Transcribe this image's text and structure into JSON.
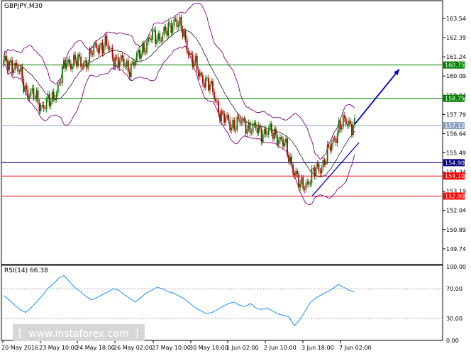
{
  "colors": {
    "frame": "#000000",
    "candle_up": "#008000",
    "candle_down": "#b00000",
    "bollinger": "#800080",
    "ma": "#000000",
    "rsi": "#1e90ff",
    "trend_arrow": "#0000cc",
    "green_level": "#008000",
    "blue_level": "#000080",
    "red_level": "#ff0000",
    "gray_level": "#8ea2c6",
    "watermark_bg": "#d6d6d6"
  },
  "header": {
    "symbol": "GBPJPY,M30",
    "rsi_title": "RSI(14) 66.38",
    "watermark": "www.instaforex.com"
  },
  "chart_data": [
    {
      "type": "candlestick",
      "symbol": "GBPJPY",
      "timeframe": "M30",
      "ylim": [
        148.8,
        164.6
      ],
      "grid": false,
      "y_ticks": [
        "163.54",
        "162.39",
        "161.24",
        "160.09",
        "158.94",
        "157.79",
        "156.64",
        "155.49",
        "154.34",
        "153.19",
        "152.04",
        "150.89",
        "149.74"
      ],
      "x_tick_labels": [
        "20 May 2016",
        "23 May 10:00",
        "24 May 18:00",
        "26 May 02:00",
        "27 May 10:00",
        "30 May 18:00",
        "1 Jun 02:00",
        "2 Jun 10:00",
        "3 Jun 18:00",
        "7 Jun 02:00"
      ],
      "close_anchors": [
        160.8,
        160.9,
        160.3,
        159.2,
        158.8,
        158.3,
        158.5,
        159.5,
        160.9,
        161.0,
        160.8,
        161.2,
        161.9,
        162.0,
        161.3,
        160.9,
        160.6,
        161.0,
        161.9,
        162.4,
        162.5,
        162.7,
        163.6,
        162.6,
        161.3,
        160.2,
        159.8,
        158.9,
        157.6,
        157.2,
        157.3,
        157.2,
        156.9,
        156.8,
        156.7,
        156.6,
        155.9,
        154.8,
        153.4,
        153.8,
        154.4,
        154.9,
        155.9,
        157.1,
        157.3,
        157.2
      ],
      "levels": [
        {
          "value": 160.75,
          "label": "160.75",
          "kind": "resistance"
        },
        {
          "value": 158.75,
          "label": "158.75",
          "kind": "resistance"
        },
        {
          "value": 157.12,
          "label": "157.12",
          "kind": "current"
        },
        {
          "value": 154.9,
          "label": "154.90",
          "kind": "pivot"
        },
        {
          "value": 154.1,
          "label": "154.10",
          "kind": "support"
        },
        {
          "value": 152.9,
          "label": "152.90",
          "kind": "support"
        }
      ],
      "trendline": {
        "from_price": 152.9,
        "to_price": 156.1
      },
      "arrow": {
        "from_price": 157.2,
        "to_price": 160.5
      },
      "indicators": [
        "Bollinger Bands",
        "Moving Average"
      ]
    },
    {
      "type": "line",
      "name": "RSI(14)",
      "last_value": 66.38,
      "ylim": [
        0,
        100
      ],
      "y_ticks": [
        "100.00",
        "70.00",
        "30.00",
        "0.00"
      ],
      "levels": [
        70,
        30
      ],
      "values": [
        61,
        55,
        48,
        42,
        38,
        44,
        52,
        60,
        70,
        76,
        84,
        88,
        80,
        72,
        66,
        60,
        55,
        58,
        62,
        66,
        70,
        68,
        62,
        57,
        52,
        58,
        64,
        68,
        72,
        70,
        66,
        64,
        60,
        56,
        50,
        44,
        40,
        36,
        38,
        42,
        46,
        50,
        52,
        48,
        46,
        50,
        44,
        42,
        44,
        40,
        36,
        34,
        32,
        20,
        28,
        40,
        52,
        58,
        62,
        66,
        70,
        76,
        72,
        68,
        66
      ]
    }
  ]
}
